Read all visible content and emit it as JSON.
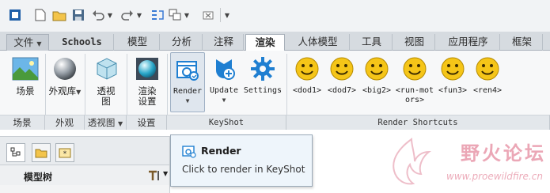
{
  "ribbon_tabs": [
    {
      "label": "文件",
      "has_dropdown": true
    },
    {
      "label": "Schools"
    },
    {
      "label": "模型"
    },
    {
      "label": "分析"
    },
    {
      "label": "注释"
    },
    {
      "label": "渲染",
      "active": true
    },
    {
      "label": "人体模型"
    },
    {
      "label": "工具"
    },
    {
      "label": "视图"
    },
    {
      "label": "应用程序"
    },
    {
      "label": "框架"
    }
  ],
  "ribbon_buttons": {
    "scene": "场景",
    "appearance_library": "外观库",
    "perspective": "透视图",
    "render_settings": "渲染设置",
    "render": "Render",
    "update": "Update",
    "settings": "Settings",
    "dod1": "<dod1>",
    "dod7": "<dod7>",
    "big2": "<big2>",
    "run_motors": "<run-motors>",
    "fun3": "<fun3>",
    "ren4": "<ren4>"
  },
  "groups": {
    "scene": "场景",
    "appearance": "外观",
    "perspective": "透视图",
    "settings": "设置",
    "keyshot": "KeyShot",
    "render_shortcuts": "Render Shortcuts"
  },
  "panel": {
    "model_tree_title": "模型树"
  },
  "tooltip": {
    "title": "Render",
    "description": "Click to render in KeyShot"
  },
  "watermark": {
    "name": "野火论坛",
    "url": "www.proewildfire.cn"
  },
  "colors": {
    "accent_blue": "#1f7fd1",
    "smiley_yellow": "#f5c518",
    "active_tab": "#ffffff",
    "ribbon_bg": "#f7f8f9"
  }
}
